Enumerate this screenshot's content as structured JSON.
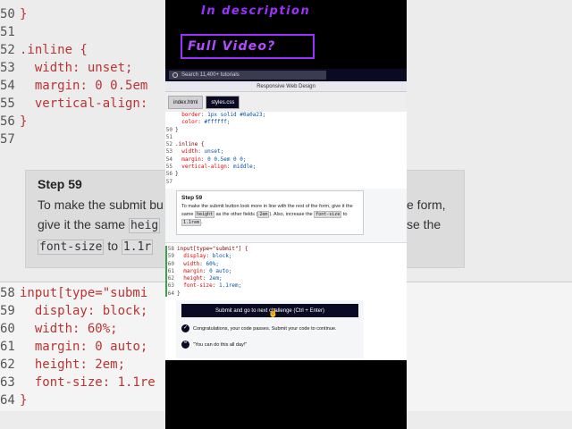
{
  "overlay": {
    "top_text": "In description",
    "box_text": "Full Video?"
  },
  "search": {
    "placeholder": "Search 11,400+ tutorials"
  },
  "course_title": "Responsive Web Design",
  "tabs": [
    {
      "label": "index.html",
      "active": false
    },
    {
      "label": "styles.css",
      "active": true
    }
  ],
  "code_top": [
    {
      "ln": "",
      "text": "  border: 1px solid #0a0a23;"
    },
    {
      "ln": "",
      "text": "  color: #ffffff;"
    },
    {
      "ln": "50",
      "text": "}"
    },
    {
      "ln": "51",
      "text": ""
    },
    {
      "ln": "52",
      "text": ".inline {"
    },
    {
      "ln": "53",
      "text": "  width: unset;"
    },
    {
      "ln": "54",
      "text": "  margin: 0 0.5em 0 0;"
    },
    {
      "ln": "55",
      "text": "  vertical-align: middle;"
    },
    {
      "ln": "56",
      "text": "}"
    },
    {
      "ln": "57",
      "text": ""
    }
  ],
  "step": {
    "title": "Step 59",
    "text_1": "To make the submit button look more in line with the rest of the form, give it the same",
    "chip_1": "height",
    "text_2": "as the other fields (",
    "chip_2": "2em",
    "text_3": "). Also, increase the",
    "chip_3": "font-size",
    "text_4": "to",
    "chip_4": "1.1rem",
    "text_5": "."
  },
  "code_bottom": [
    {
      "ln": "58",
      "text": "input[type=\"submit\"] {"
    },
    {
      "ln": "59",
      "text": "  display: block;"
    },
    {
      "ln": "60",
      "text": "  width: 60%;"
    },
    {
      "ln": "61",
      "text": "  margin: 0 auto;"
    },
    {
      "ln": "62",
      "text": "  height: 2em;"
    },
    {
      "ln": "63",
      "text": "  font-size: 1.1rem;"
    },
    {
      "ln": "64",
      "text": "}"
    }
  ],
  "result": {
    "submit_label": "Submit and go to next challenge (Ctrl + Enter)",
    "message_1": "Congratulations, your code passes. Submit your code to continue.",
    "message_2": "\"You can do this all day!\""
  },
  "background": {
    "left_lines": [
      {
        "ln": "50",
        "text": "}"
      },
      {
        "ln": "51",
        "text": ""
      },
      {
        "ln": "52",
        "text": ".inline {"
      },
      {
        "ln": "53",
        "text": "  width: unset;"
      },
      {
        "ln": "54",
        "text": "  margin: 0 0.5em"
      },
      {
        "ln": "55",
        "text": "  vertical-align:"
      },
      {
        "ln": "56",
        "text": "}"
      },
      {
        "ln": "57",
        "text": ""
      }
    ],
    "step_title": "Step 59",
    "step_line_1": "To make the submit bu",
    "step_line_2": "give it the same",
    "step_chip_1": "heig",
    "step_chip_2": "font-size",
    "step_word_to": "to",
    "step_chip_3": "1.1r",
    "right_line_1": "e form,",
    "right_line_2": "se the",
    "lower_lines": [
      {
        "ln": "58",
        "text": "input[type=\"submi"
      },
      {
        "ln": "59",
        "text": "  display: block;"
      },
      {
        "ln": "60",
        "text": "  width: 60%;"
      },
      {
        "ln": "61",
        "text": "  margin: 0 auto;"
      },
      {
        "ln": "62",
        "text": "  height: 2em;"
      },
      {
        "ln": "63",
        "text": "  font-size: 1.1re"
      },
      {
        "ln": "64",
        "text": "}"
      }
    ]
  },
  "colors": {
    "brand_dark": "#0a0a23",
    "overlay_purple": "#9b30ff",
    "pass_green": "#3fa24b"
  }
}
